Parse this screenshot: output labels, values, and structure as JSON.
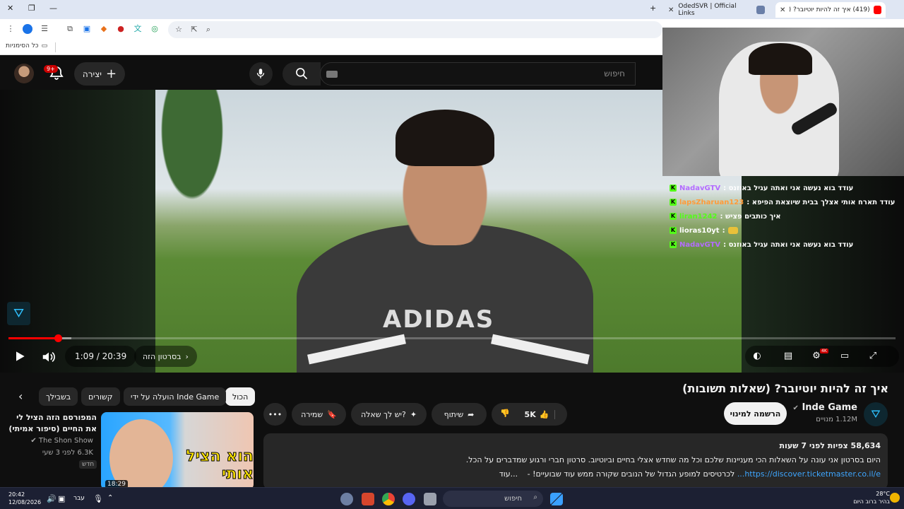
{
  "browser": {
    "tabs": [
      {
        "title": "(419) איך זה להיות יוטיובר? (שא...",
        "active": true
      },
      {
        "title": "",
        "active": false
      },
      {
        "title": "OdedSVR | Official Links",
        "active": false
      }
    ],
    "new_tab": "+",
    "bookmarks_label": "כל הסימניות"
  },
  "youtube": {
    "search_placeholder": "חיפוש",
    "create_label": "יצירה",
    "notif_count": "9+"
  },
  "player": {
    "time_current": "1:09",
    "time_total": "20:39",
    "time_display": "1:09 / 20:39",
    "chapter_label": "בסרטון הזה",
    "progress_fraction": 0.056,
    "buffer_fraction": 0.071,
    "jersey_text": "ADIDAS"
  },
  "chat": [
    {
      "user": "NadavGTV",
      "user_color": "#b36bff",
      "text": ": עודד בוא נעשה אני ואתה עגיל באוזנס"
    },
    {
      "user": "lapsZharuan123",
      "user_color": "#ff9b3a",
      "text": ": עודד תארח אותי אצלך בבית שיוצאת הפיפא"
    },
    {
      "user": "liran1242",
      "user_color": "#53fc18",
      "text": ": איך כותבים פציש"
    },
    {
      "user": "lioras10yt",
      "user_color": "#ffffff",
      "text": ":"
    },
    {
      "user": "NadavGTV",
      "user_color": "#b36bff",
      "text": ": עודד בוא נעשה אני ואתה עגיל באוזנס"
    }
  ],
  "video": {
    "title": "איך זה להיות יוטיובר? (שאלות תשובות)",
    "channel_name": "Inde Game",
    "subscribers": "1.12M מנויים",
    "subscribe_label": "הרשמה למינוי",
    "likes": "5K",
    "share_label": "שיתוף",
    "ask_label": "יש לך שאלה?",
    "save_label": "שמירה",
    "more_label": "•••",
    "description": {
      "meta": "58,634 צפיות  לפני 7 שעות",
      "line1": "היום בסרטון אני עונה על השאלות הכי מעניינות שלכם וכל מה שחדש אצלי בחיים וביוטיוב. סרטון חברי ורגוע שמדברים על הכל.",
      "line2_link": "https://discover.ticketmaster.co.il/e...",
      "line2_text": "לכרטיסים למופע הגדול של הנובים שקורה ממש עוד שבועיים! -",
      "more": "...עוד"
    }
  },
  "recs": {
    "chips": [
      "הכול",
      "הועלה על ידי Inde Game",
      "קשורים",
      "בשבילך"
    ],
    "item": {
      "title": "המפורסם הזה הציל לי את החיים (סיפור אמיתי)",
      "channel": "The Shon Show",
      "views": "6.3K  לפני 3 שעי",
      "badge": "חדש",
      "duration": "18:29",
      "thumb_text": "הוא הציל אותי"
    }
  },
  "taskbar": {
    "time": "20:42",
    "date": "12/08/2026",
    "lang": "עבר",
    "search_label": "חיפוש",
    "weather_temp": "28°C",
    "weather_desc": "בהיר ברוב היום"
  }
}
